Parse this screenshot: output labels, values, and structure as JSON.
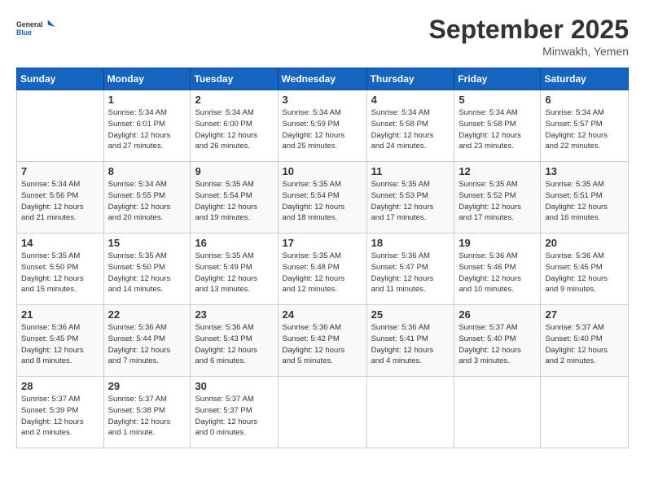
{
  "header": {
    "logo_general": "General",
    "logo_blue": "Blue",
    "month_title": "September 2025",
    "location": "Minwakh, Yemen"
  },
  "days_of_week": [
    "Sunday",
    "Monday",
    "Tuesday",
    "Wednesday",
    "Thursday",
    "Friday",
    "Saturday"
  ],
  "weeks": [
    [
      {
        "day": "",
        "info": ""
      },
      {
        "day": "1",
        "info": "Sunrise: 5:34 AM\nSunset: 6:01 PM\nDaylight: 12 hours\nand 27 minutes."
      },
      {
        "day": "2",
        "info": "Sunrise: 5:34 AM\nSunset: 6:00 PM\nDaylight: 12 hours\nand 26 minutes."
      },
      {
        "day": "3",
        "info": "Sunrise: 5:34 AM\nSunset: 5:59 PM\nDaylight: 12 hours\nand 25 minutes."
      },
      {
        "day": "4",
        "info": "Sunrise: 5:34 AM\nSunset: 5:58 PM\nDaylight: 12 hours\nand 24 minutes."
      },
      {
        "day": "5",
        "info": "Sunrise: 5:34 AM\nSunset: 5:58 PM\nDaylight: 12 hours\nand 23 minutes."
      },
      {
        "day": "6",
        "info": "Sunrise: 5:34 AM\nSunset: 5:57 PM\nDaylight: 12 hours\nand 22 minutes."
      }
    ],
    [
      {
        "day": "7",
        "info": "Sunrise: 5:34 AM\nSunset: 5:56 PM\nDaylight: 12 hours\nand 21 minutes."
      },
      {
        "day": "8",
        "info": "Sunrise: 5:34 AM\nSunset: 5:55 PM\nDaylight: 12 hours\nand 20 minutes."
      },
      {
        "day": "9",
        "info": "Sunrise: 5:35 AM\nSunset: 5:54 PM\nDaylight: 12 hours\nand 19 minutes."
      },
      {
        "day": "10",
        "info": "Sunrise: 5:35 AM\nSunset: 5:54 PM\nDaylight: 12 hours\nand 18 minutes."
      },
      {
        "day": "11",
        "info": "Sunrise: 5:35 AM\nSunset: 5:53 PM\nDaylight: 12 hours\nand 17 minutes."
      },
      {
        "day": "12",
        "info": "Sunrise: 5:35 AM\nSunset: 5:52 PM\nDaylight: 12 hours\nand 17 minutes."
      },
      {
        "day": "13",
        "info": "Sunrise: 5:35 AM\nSunset: 5:51 PM\nDaylight: 12 hours\nand 16 minutes."
      }
    ],
    [
      {
        "day": "14",
        "info": "Sunrise: 5:35 AM\nSunset: 5:50 PM\nDaylight: 12 hours\nand 15 minutes."
      },
      {
        "day": "15",
        "info": "Sunrise: 5:35 AM\nSunset: 5:50 PM\nDaylight: 12 hours\nand 14 minutes."
      },
      {
        "day": "16",
        "info": "Sunrise: 5:35 AM\nSunset: 5:49 PM\nDaylight: 12 hours\nand 13 minutes."
      },
      {
        "day": "17",
        "info": "Sunrise: 5:35 AM\nSunset: 5:48 PM\nDaylight: 12 hours\nand 12 minutes."
      },
      {
        "day": "18",
        "info": "Sunrise: 5:36 AM\nSunset: 5:47 PM\nDaylight: 12 hours\nand 11 minutes."
      },
      {
        "day": "19",
        "info": "Sunrise: 5:36 AM\nSunset: 5:46 PM\nDaylight: 12 hours\nand 10 minutes."
      },
      {
        "day": "20",
        "info": "Sunrise: 5:36 AM\nSunset: 5:45 PM\nDaylight: 12 hours\nand 9 minutes."
      }
    ],
    [
      {
        "day": "21",
        "info": "Sunrise: 5:36 AM\nSunset: 5:45 PM\nDaylight: 12 hours\nand 8 minutes."
      },
      {
        "day": "22",
        "info": "Sunrise: 5:36 AM\nSunset: 5:44 PM\nDaylight: 12 hours\nand 7 minutes."
      },
      {
        "day": "23",
        "info": "Sunrise: 5:36 AM\nSunset: 5:43 PM\nDaylight: 12 hours\nand 6 minutes."
      },
      {
        "day": "24",
        "info": "Sunrise: 5:36 AM\nSunset: 5:42 PM\nDaylight: 12 hours\nand 5 minutes."
      },
      {
        "day": "25",
        "info": "Sunrise: 5:36 AM\nSunset: 5:41 PM\nDaylight: 12 hours\nand 4 minutes."
      },
      {
        "day": "26",
        "info": "Sunrise: 5:37 AM\nSunset: 5:40 PM\nDaylight: 12 hours\nand 3 minutes."
      },
      {
        "day": "27",
        "info": "Sunrise: 5:37 AM\nSunset: 5:40 PM\nDaylight: 12 hours\nand 2 minutes."
      }
    ],
    [
      {
        "day": "28",
        "info": "Sunrise: 5:37 AM\nSunset: 5:39 PM\nDaylight: 12 hours\nand 2 minutes."
      },
      {
        "day": "29",
        "info": "Sunrise: 5:37 AM\nSunset: 5:38 PM\nDaylight: 12 hours\nand 1 minute."
      },
      {
        "day": "30",
        "info": "Sunrise: 5:37 AM\nSunset: 5:37 PM\nDaylight: 12 hours\nand 0 minutes."
      },
      {
        "day": "",
        "info": ""
      },
      {
        "day": "",
        "info": ""
      },
      {
        "day": "",
        "info": ""
      },
      {
        "day": "",
        "info": ""
      }
    ]
  ]
}
